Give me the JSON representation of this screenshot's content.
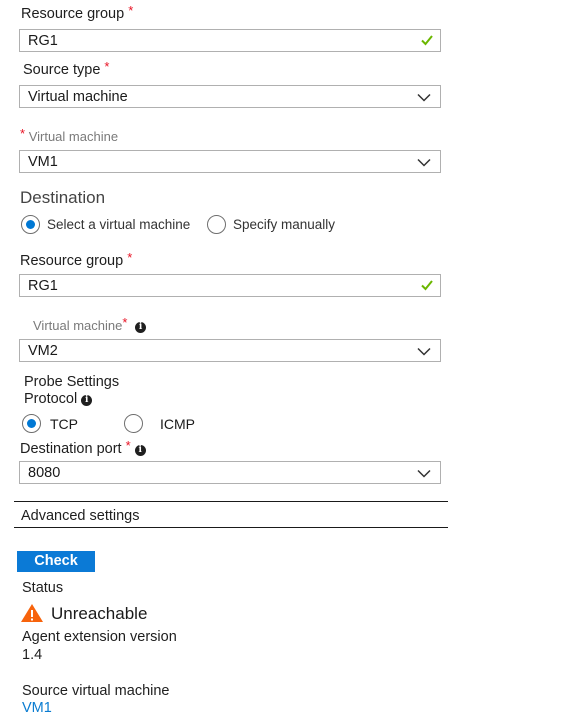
{
  "source": {
    "resource_group": {
      "label": "Resource group",
      "required": "*",
      "value": "RG1"
    },
    "source_type": {
      "label": "Source type",
      "required": "*",
      "value": "Virtual machine"
    },
    "virtual_machine": {
      "label": "Virtual machine",
      "required": "*",
      "value": "VM1"
    }
  },
  "destination": {
    "heading": "Destination",
    "mode_options": [
      {
        "label": "Select a virtual machine",
        "selected": true
      },
      {
        "label": "Specify manually",
        "selected": false
      }
    ],
    "resource_group": {
      "label": "Resource group",
      "required": "*",
      "value": "RG1"
    },
    "virtual_machine": {
      "label": "Virtual machine",
      "required": "*",
      "value": "VM2"
    }
  },
  "probe": {
    "heading": "Probe Settings",
    "protocol_label": "Protocol",
    "protocol_options": [
      {
        "label": "TCP",
        "selected": true
      },
      {
        "label": "ICMP",
        "selected": false
      }
    ],
    "destination_port": {
      "label": "Destination port",
      "required": "*",
      "value": "8080"
    }
  },
  "advanced_settings_label": "Advanced settings",
  "check_button_label": "Check",
  "result": {
    "status_label": "Status",
    "status_value": "Unreachable",
    "agent_version_label": "Agent extension version",
    "agent_version_value": "1.4",
    "source_vm_label": "Source virtual machine",
    "source_vm_value": "VM1"
  },
  "icons": {
    "info": "i",
    "valid": "checkmark-icon",
    "dropdown": "chevron-down-icon",
    "warning": "warning-triangle-icon"
  },
  "colors": {
    "accent": "#0078d4",
    "required": "#e81123",
    "valid": "#6bb700",
    "warning": "#f7630c",
    "link": "#0a7cd1"
  }
}
